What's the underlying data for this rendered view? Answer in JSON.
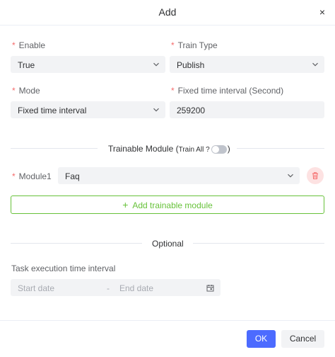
{
  "dialog": {
    "title": "Add",
    "close_glyph": "×"
  },
  "form": {
    "enable": {
      "label": "Enable",
      "value": "True"
    },
    "train_type": {
      "label": "Train Type",
      "value": "Publish"
    },
    "mode": {
      "label": "Mode",
      "value": "Fixed time interval"
    },
    "fixed_interval": {
      "label": "Fixed time interval (Second)",
      "value": "259200"
    },
    "required_mark": "*"
  },
  "trainable": {
    "heading_start": "Trainable Module (",
    "train_all_label": "Train All ?",
    "heading_end": ")",
    "train_all_enabled": false,
    "modules": [
      {
        "label": "Module1",
        "value": "Faq"
      }
    ],
    "add_label": "Add trainable module",
    "add_glyph": "+"
  },
  "optional": {
    "heading": "Optional",
    "task_interval_label": "Task execution time interval",
    "start_placeholder": "Start date",
    "range_separator": "-",
    "end_placeholder": "End date"
  },
  "footer": {
    "ok_label": "OK",
    "cancel_label": "Cancel"
  },
  "colors": {
    "primary": "#4c6bff",
    "success": "#67c23a",
    "danger": "#f56c6c",
    "danger_bg": "#fde2e2",
    "field_bg": "#f2f3f5"
  },
  "icons": {
    "chevron": "chevron-down-icon",
    "delete": "trash-icon",
    "calendar": "calendar-icon",
    "close": "close-icon",
    "plus": "plus-icon"
  }
}
